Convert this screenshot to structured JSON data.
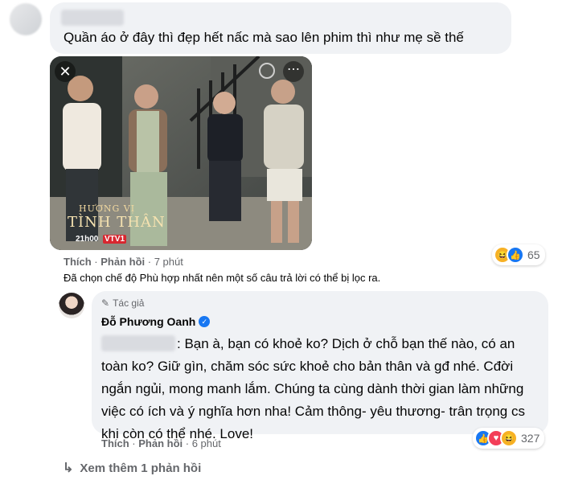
{
  "comment1": {
    "text": "Quần áo ở đây thì đẹp hết nấc mà sao lên phim thì như mẹ sề thế",
    "image": {
      "show_title_top": "HƯƠNG VỊ",
      "show_title_bottom": "TÌNH THÂN",
      "airtime": "21h00",
      "channel": "VTV1"
    },
    "actions": {
      "like": "Thích",
      "reply": "Phản hồi",
      "time": "7 phút"
    },
    "reactions": {
      "count": "65"
    },
    "filter_notice": "Đã chọn chế độ Phù hợp nhất nên một số câu trả lời có thể bị lọc ra."
  },
  "reply1": {
    "author_badge": "Tác giả",
    "author_name": "Đỗ Phương Oanh",
    "text": ": Bạn à, bạn có khoẻ ko? Dịch ở chỗ bạn thế nào, có an toàn ko? Giữ gìn, chăm sóc sức khoẻ cho bản thân và gđ nhé. Cđời ngắn ngủi, mong manh lắm. Chúng ta cùng dành thời gian làm những việc có ích và ý nghĩa hơn nha! Cảm thông- yêu thương- trân trọng cs khi còn có thể nhé. Love!",
    "actions": {
      "like": "Thích",
      "reply": "Phản hồi",
      "time": "6 phút"
    },
    "reactions": {
      "count": "327"
    }
  },
  "more_replies": {
    "label": "Xem thêm 1 phản hồi"
  },
  "colors": {
    "accent": "#1877f2",
    "bubble": "#f0f2f5",
    "meta": "#65676b"
  }
}
